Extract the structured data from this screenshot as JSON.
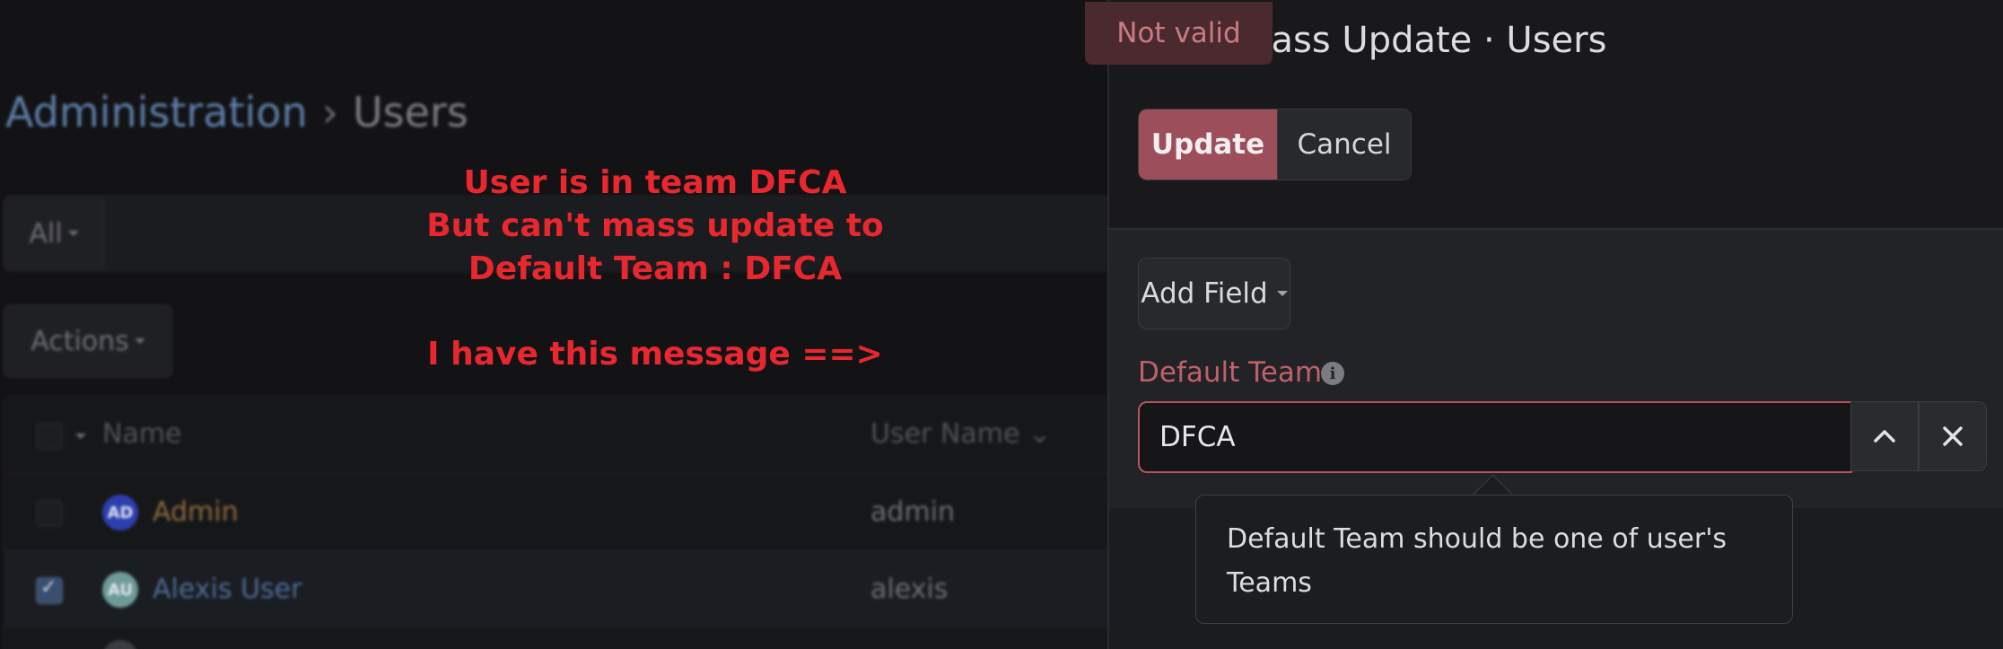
{
  "breadcrumb": {
    "root": "Administration",
    "separator": "›",
    "current": "Users"
  },
  "filters": {
    "all_label": "All"
  },
  "actions": {
    "label": "Actions"
  },
  "table": {
    "columns": {
      "name": "Name",
      "username": "User Name"
    },
    "rows": [
      {
        "initials": "AD",
        "name": "Admin",
        "username": "admin",
        "checked": false,
        "avatar_color": "#2d3fae",
        "name_color": "#8a6a3e"
      },
      {
        "initials": "AU",
        "name": "Alexis User",
        "username": "alexis",
        "checked": true,
        "avatar_color": "#6e9a97",
        "name_color": "#4f6c94"
      }
    ]
  },
  "annotation": {
    "lines": [
      "User is in team DFCA",
      "But can't mass update to",
      "Default Team : DFCA"
    ],
    "message": "I have this message ==>"
  },
  "modal": {
    "title": "Mass Update · Users",
    "update_label": "Update",
    "cancel_label": "Cancel",
    "add_field_label": "Add Field",
    "field_label": "Default Team",
    "field_value": "DFCA",
    "tooltip": "Default Team should be one of user's Teams"
  },
  "toast": {
    "text": "Not valid"
  },
  "colors": {
    "accent": "#9c4f5a",
    "error": "#c0606a",
    "annotation": "#e8272e"
  }
}
